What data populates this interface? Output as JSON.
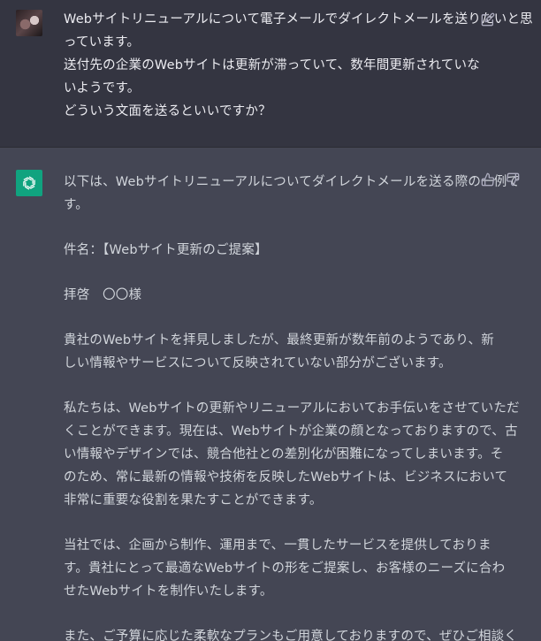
{
  "user_message": {
    "lines": [
      "Webサイトリニューアルについて電子メールでダイレクトメールを送りたいと思",
      "っています。",
      "送付先の企業のWebサイトは更新が滞っていて、数年間更新されていな",
      "いようです。",
      "どういう文面を送るといいですか？"
    ]
  },
  "assistant_message": {
    "paragraphs": [
      [
        "以下は、Webサイトリニューアルについてダイレクトメールを送る際の一例で",
        "す。"
      ],
      [
        "件名：【Webサイト更新のご提案】"
      ],
      [
        "拝啓　〇〇様"
      ],
      [
        "貴社のWebサイトを拝見しましたが、最終更新が数年前のようであり、新",
        "しい情報やサービスについて反映されていない部分がございます。"
      ],
      [
        "私たちは、Webサイトの更新やリニューアルにおいてお手伝いをさせていただ",
        "くことができます。現在は、Webサイトが企業の顔となっておりますので、古",
        "い情報やデザインでは、競合他社との差別化が困難になってしまいます。そ",
        "のため、常に最新の情報や技術を反映したWebサイトは、ビジネスにおいて",
        "非常に重要な役割を果たすことができます。"
      ],
      [
        "当社では、企画から制作、運用まで、一貫したサービスを提供しておりま",
        "す。貴社にとって最適なWebサイトの形をご提案し、お客様のニーズに合わ",
        "せたWebサイトを制作いたします。"
      ],
      [
        "また、ご予算に応じた柔軟なプランもご用意しておりますので、ぜひご相談く"
      ]
    ]
  },
  "icons": {
    "user_avatar": "user-avatar",
    "bot_avatar": "openai-logo-icon",
    "edit": "edit-icon",
    "thumbs_up": "thumbs-up-icon",
    "thumbs_down": "thumbs-down-icon"
  },
  "colors": {
    "user_bg": "#343541",
    "assistant_bg": "#444654",
    "bot_avatar_bg": "#10a37f"
  }
}
